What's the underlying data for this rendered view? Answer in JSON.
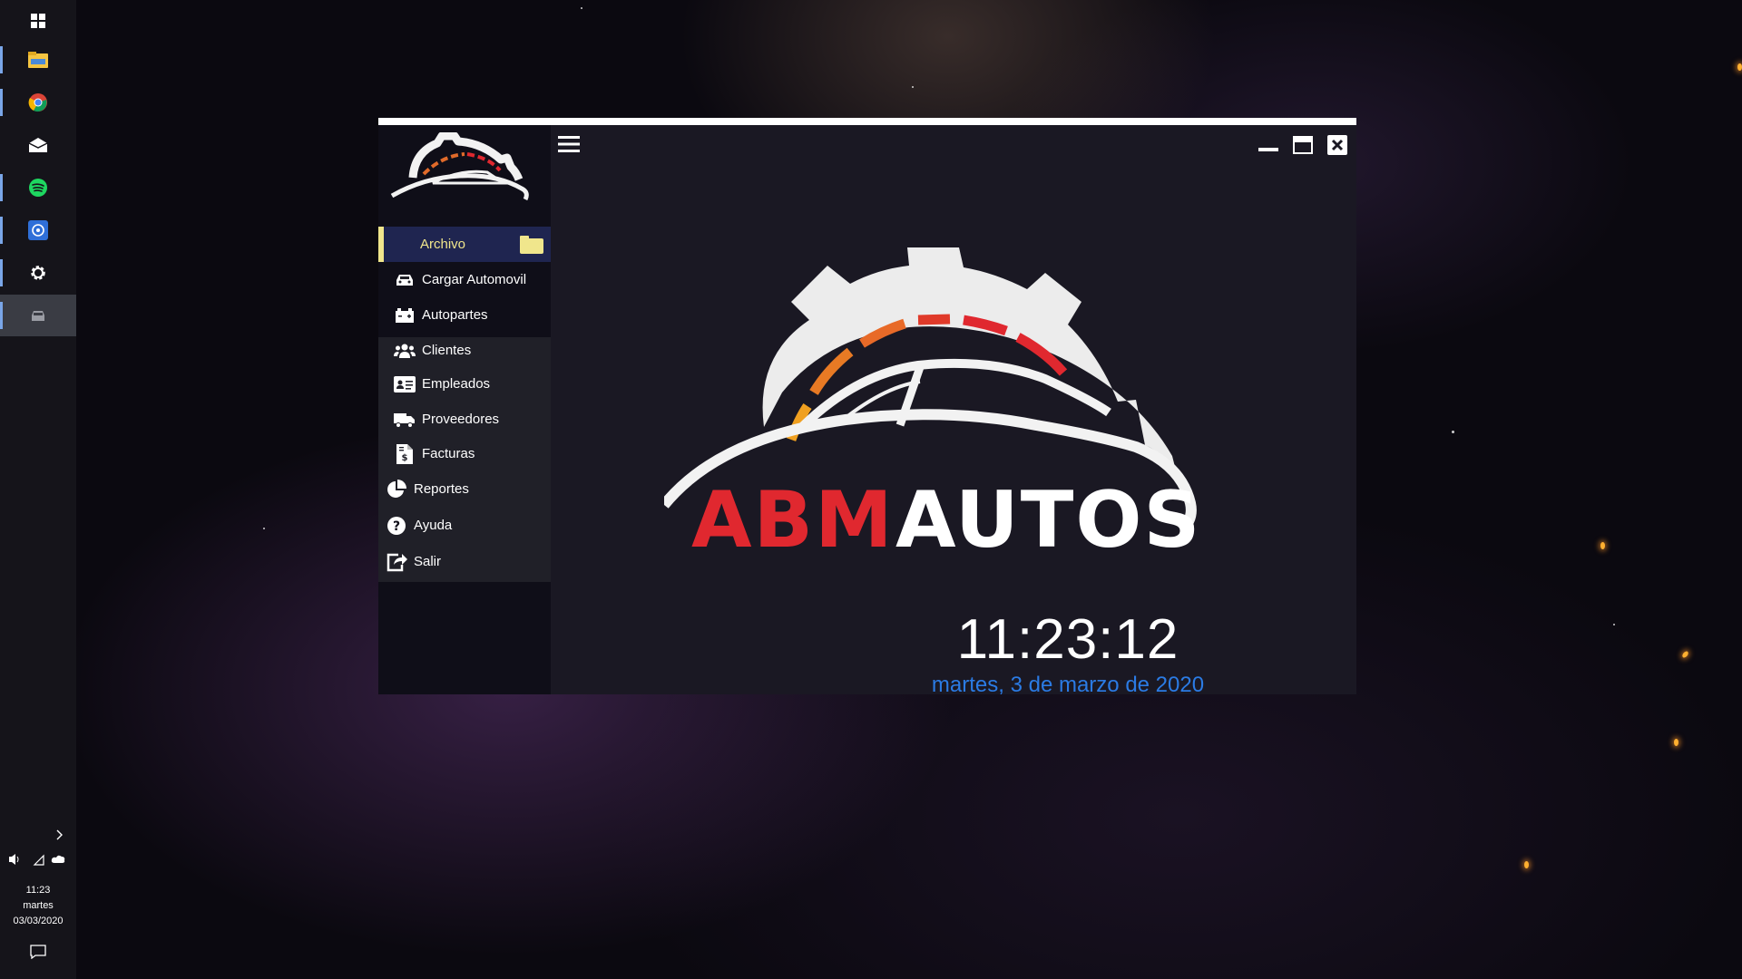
{
  "taskbar": {
    "apps": [
      {
        "name": "start",
        "icon": "windows-icon"
      },
      {
        "name": "file-explorer",
        "icon": "folder-icon"
      },
      {
        "name": "chrome",
        "icon": "chrome-icon"
      },
      {
        "name": "mail",
        "icon": "mail-icon"
      },
      {
        "name": "spotify",
        "icon": "spotify-icon"
      },
      {
        "name": "whatsapp",
        "icon": "whatsapp-icon"
      },
      {
        "name": "settings",
        "icon": "gear-icon"
      },
      {
        "name": "abm-autos",
        "icon": "car-icon"
      }
    ],
    "clock": {
      "time": "11:23",
      "day": "martes",
      "date": "03/03/2020"
    }
  },
  "app": {
    "menu": {
      "archivo": "Archivo",
      "cargar": "Cargar Automovil",
      "autopartes": "Autopartes",
      "clientes": "Clientes",
      "empleados": "Empleados",
      "proveedores": "Proveedores",
      "facturas": "Facturas",
      "reportes": "Reportes",
      "ayuda": "Ayuda",
      "salir": "Salir"
    },
    "brand": {
      "part1": "ABM",
      "part2": "AUTOS"
    },
    "clock": {
      "time": "11:23:12",
      "date": "martes, 3 de marzo de 2020"
    },
    "colors": {
      "accent": "#f0e68c",
      "brand_red": "#e0282f",
      "date_blue": "#2b7be4"
    }
  }
}
